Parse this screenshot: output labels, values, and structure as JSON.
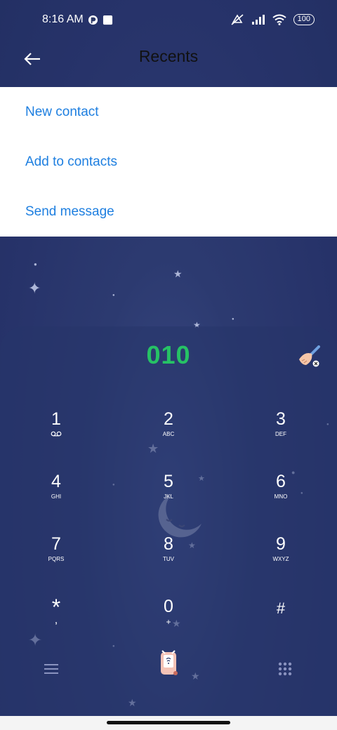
{
  "status_bar": {
    "time": "8:16 AM",
    "battery": "100",
    "icons": [
      "browser-icon",
      "notification-square-icon",
      "mute-icon",
      "signal-icon",
      "wifi-icon",
      "battery-icon"
    ]
  },
  "header": {
    "title": "Recents",
    "back_icon": "back-arrow-icon"
  },
  "menu": {
    "items": [
      {
        "label": "New contact"
      },
      {
        "label": "Add to contacts"
      },
      {
        "label": "Send message"
      }
    ],
    "color": "#1e7fe0"
  },
  "dialer": {
    "number": "010",
    "number_color": "#26c265",
    "clear_icon": "broom-clear-icon",
    "keys": [
      {
        "digit": "1",
        "letters": "voicemail-icon"
      },
      {
        "digit": "2",
        "letters": "ABC"
      },
      {
        "digit": "3",
        "letters": "DEF"
      },
      {
        "digit": "4",
        "letters": "GHI"
      },
      {
        "digit": "5",
        "letters": "JKL"
      },
      {
        "digit": "6",
        "letters": "MNO"
      },
      {
        "digit": "7",
        "letters": "PQRS"
      },
      {
        "digit": "8",
        "letters": "TUV"
      },
      {
        "digit": "9",
        "letters": "WXYZ"
      },
      {
        "digit": "*",
        "letters": ","
      },
      {
        "digit": "0",
        "letters": "+"
      },
      {
        "digit": "#",
        "letters": ""
      }
    ]
  },
  "bottom_bar": {
    "menu_icon": "hamburger-menu-icon",
    "call_icon": "phone-call-icon",
    "dialpad_icon": "dialpad-grid-icon"
  }
}
